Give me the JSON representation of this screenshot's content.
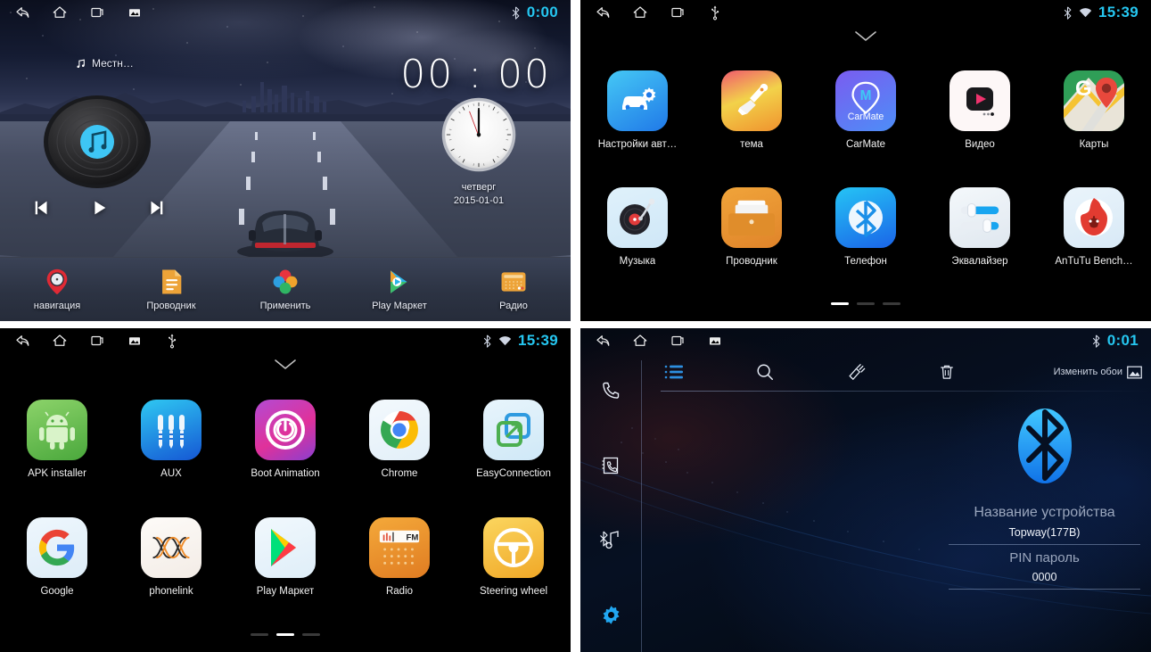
{
  "meta": {
    "accent_cyan": "#25c6f0",
    "accent_blue": "#1e9cf0",
    "bg_black": "#000000"
  },
  "panels": {
    "home": {
      "name": "home-screen",
      "statusbar": {
        "icons": [
          "back-icon",
          "home-icon",
          "recents-icon",
          "screenshot-icon"
        ],
        "bluetooth": "bluetooth-icon",
        "time": "0:00"
      },
      "now_playing": {
        "icon": "music-note-icon",
        "text": "Местн…"
      },
      "digital_clock": "00 : 00",
      "analog": {
        "weekday": "четверг",
        "date": "2015-01-01"
      },
      "player": {
        "disc_icon": "vinyl-record-icon",
        "prev": "previous-track-icon",
        "play": "play-icon",
        "next": "next-track-icon"
      },
      "dock": [
        {
          "label": "навигация",
          "icon": "navigation-pin-icon"
        },
        {
          "label": "Проводник",
          "icon": "file-manager-icon"
        },
        {
          "label": "Применить",
          "icon": "apply-petals-icon"
        },
        {
          "label": "Play Маркет",
          "icon": "play-store-icon"
        },
        {
          "label": "Радио",
          "icon": "radio-icon"
        }
      ]
    },
    "drawer_page1": {
      "name": "app-drawer-page-1",
      "statusbar": {
        "icons": [
          "back-icon",
          "home-icon",
          "recents-icon",
          "usb-icon"
        ],
        "bluetooth": "bluetooth-icon",
        "wifi": "wifi-icon",
        "time": "15:39"
      },
      "chevron": "chevron-down-icon",
      "apps": [
        {
          "label": "Настройки авт…",
          "icon": "car-settings-icon"
        },
        {
          "label": "тема",
          "icon": "theme-brush-icon"
        },
        {
          "label": "CarMate",
          "icon": "carmate-icon"
        },
        {
          "label": "Видео",
          "icon": "video-player-icon"
        },
        {
          "label": "Карты",
          "icon": "google-maps-icon"
        },
        {
          "label": "Музыка",
          "icon": "music-turntable-icon"
        },
        {
          "label": "Проводник",
          "icon": "file-explorer-icon"
        },
        {
          "label": "Телефон",
          "icon": "bluetooth-phone-icon"
        },
        {
          "label": "Эквалайзер",
          "icon": "equalizer-icon"
        },
        {
          "label": "AnTuTu Bench…",
          "icon": "antutu-icon"
        }
      ],
      "pager": {
        "count": 3,
        "active": 0
      }
    },
    "drawer_page2": {
      "name": "app-drawer-page-2",
      "statusbar": {
        "icons": [
          "back-icon",
          "home-icon",
          "recents-icon",
          "screenshot-icon",
          "usb-icon"
        ],
        "bluetooth": "bluetooth-icon",
        "wifi": "wifi-icon",
        "time": "15:39"
      },
      "chevron": "chevron-down-icon",
      "apps": [
        {
          "label": "APK installer",
          "icon": "android-robot-icon"
        },
        {
          "label": "AUX",
          "icon": "aux-jack-icon"
        },
        {
          "label": "Boot Animation",
          "icon": "power-ring-icon"
        },
        {
          "label": "Chrome",
          "icon": "chrome-icon"
        },
        {
          "label": "EasyConnection",
          "icon": "easyconnection-icon"
        },
        {
          "label": "Google",
          "icon": "google-g-icon"
        },
        {
          "label": "phonelink",
          "icon": "phonelink-icon"
        },
        {
          "label": "Play Маркет",
          "icon": "play-store-icon"
        },
        {
          "label": "Radio",
          "icon": "fm-radio-icon"
        },
        {
          "label": "Steering wheel",
          "icon": "steering-wheel-icon"
        }
      ],
      "pager": {
        "count": 3,
        "active": 1
      }
    },
    "bluetooth": {
      "name": "bluetooth-settings-screen",
      "statusbar": {
        "icons": [
          "back-icon",
          "home-icon",
          "recents-icon",
          "screenshot-icon"
        ],
        "bluetooth": "bluetooth-icon",
        "time": "0:01"
      },
      "sidebar": [
        {
          "icon": "dialpad-phone-icon",
          "active": false
        },
        {
          "icon": "contacts-icon",
          "active": false
        },
        {
          "icon": "bluetooth-music-icon",
          "active": false
        },
        {
          "icon": "settings-gear-icon",
          "active": true
        }
      ],
      "toolbar": {
        "buttons": [
          {
            "icon": "list-icon",
            "active": true
          },
          {
            "icon": "search-icon",
            "active": false
          },
          {
            "icon": "pick-edit-icon",
            "active": false
          },
          {
            "icon": "trash-icon",
            "active": false
          }
        ],
        "wallpaper_label": "Изменить обои",
        "wallpaper_icon": "image-icon"
      },
      "logo": "bluetooth-logo-icon",
      "fields": [
        {
          "label": "Название устройства",
          "value": "Topway(177B)"
        },
        {
          "label": "PIN пароль",
          "value": "0000"
        }
      ]
    }
  }
}
